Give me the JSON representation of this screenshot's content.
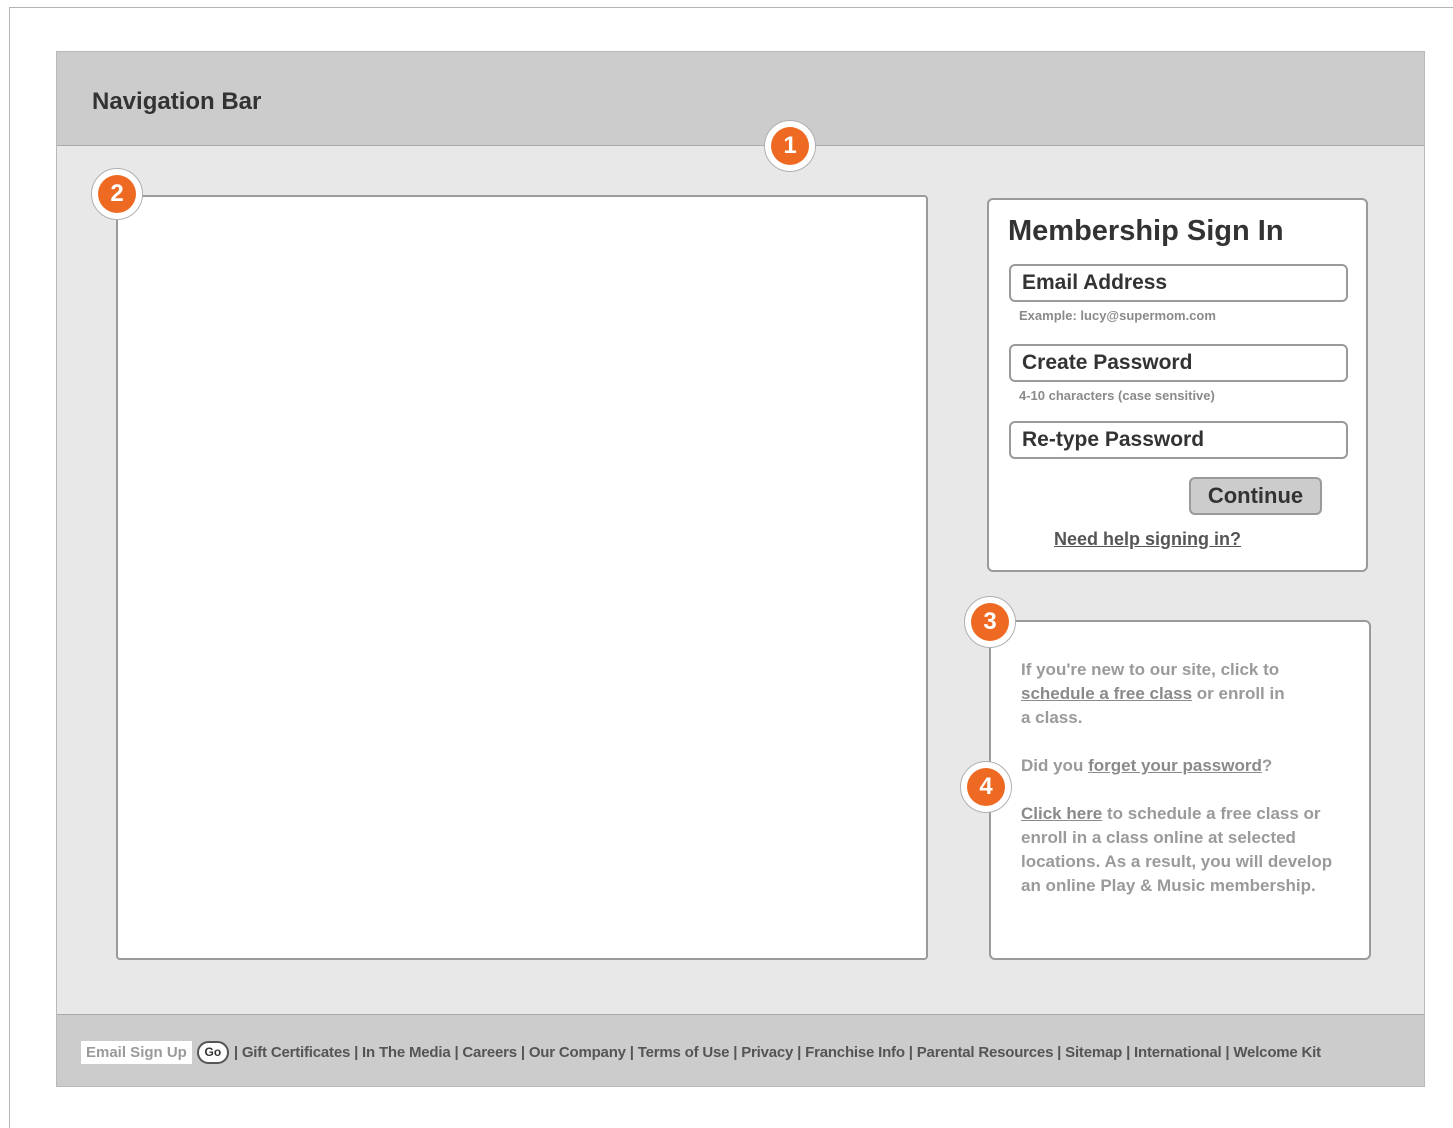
{
  "navbar": {
    "title": "Navigation Bar"
  },
  "markers": {
    "m1": "1",
    "m2": "2",
    "m3": "3",
    "m4": "4"
  },
  "signin": {
    "title": "Membership Sign In",
    "email_label": "Email Address",
    "email_hint": "Example: lucy@supermom.com",
    "password_label": "Create Password",
    "password_hint": "4-10 characters (case sensitive)",
    "retype_label": "Re-type Password",
    "continue_label": "Continue",
    "help_link": "Need help signing in?"
  },
  "info": {
    "p1_before": "If you're new to our site, click to",
    "p1_link": "schedule a free class",
    "p1_after": " or enroll in",
    "p1_end": "a class.",
    "p2_before": "Did you ",
    "p2_link": "forget your password",
    "p2_after": "?",
    "p3_link": "Click here",
    "p3_after": " to schedule a free class or enroll in a class online at selected locations. As a result, you will develop an online Play & Music membership."
  },
  "footer": {
    "email_signup": "Email Sign Up",
    "go_label": "Go",
    "links": "| Gift Certificates | In The Media | Careers | Our Company | Terms of Use | Privacy | Franchise Info | Parental Resources | Sitemap | International | Welcome Kit"
  },
  "colors": {
    "accent": "#ee6a22",
    "bar": "#cccccc",
    "canvas": "#e8e8e8"
  }
}
